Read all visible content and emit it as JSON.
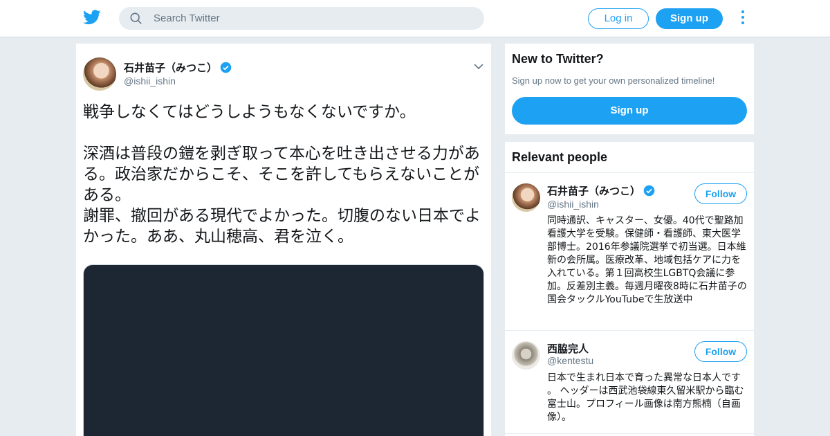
{
  "header": {
    "search_placeholder": "Search Twitter",
    "login_label": "Log in",
    "signup_label": "Sign up",
    "logo_icon": "twitter-bird-icon",
    "more_icon": "vertical-dots-icon"
  },
  "tweet": {
    "author_name": "石井苗子（みつこ）",
    "author_handle": "@ishii_ishin",
    "verified": true,
    "text": "戦争しなくてはどうしようもなくないですか。\n\n深酒は普段の鎧を剥ぎ取って本心を吐き出させる力がある。政治家だからこそ、そこを許してもらえないことがある。\n謝罪、撤回がある現代でよかった。切腹のない日本でよかった。ああ、丸山穂高、君を泣く。"
  },
  "new_to_twitter": {
    "title": "New to Twitter?",
    "subtitle": "Sign up now to get your own personalized timeline!",
    "signup_label": "Sign up"
  },
  "relevant_people": {
    "title": "Relevant people",
    "people": [
      {
        "name": "石井苗子（みつこ）",
        "handle": "@ishii_ishin",
        "verified": true,
        "bio": "同時通訳、キャスター、女優。40代で聖路加看護大学を受験。保健師・看護師、東大医学部博士。2016年参議院選挙で初当選。日本維新の会所属。医療改革、地域包括ケアに力を入れている。第１回高校生LGBTQ会議に参加。反差別主義。毎週月曜夜8時に石井苗子の国会タックルYouTubeで生放送中",
        "follow_label": "Follow"
      },
      {
        "name": "西脇完人",
        "handle": "@kentestu",
        "verified": false,
        "bio": "日本で生まれ日本で育った異常な日本人です 。 ヘッダーは西武池袋線東久留米駅から臨む富士山。プロフィール画像は南方熊楠（自画像）。",
        "follow_label": "Follow"
      }
    ]
  },
  "colors": {
    "accent": "#1da1f2",
    "background": "#e6ecf0",
    "secondary_text": "#657786"
  }
}
